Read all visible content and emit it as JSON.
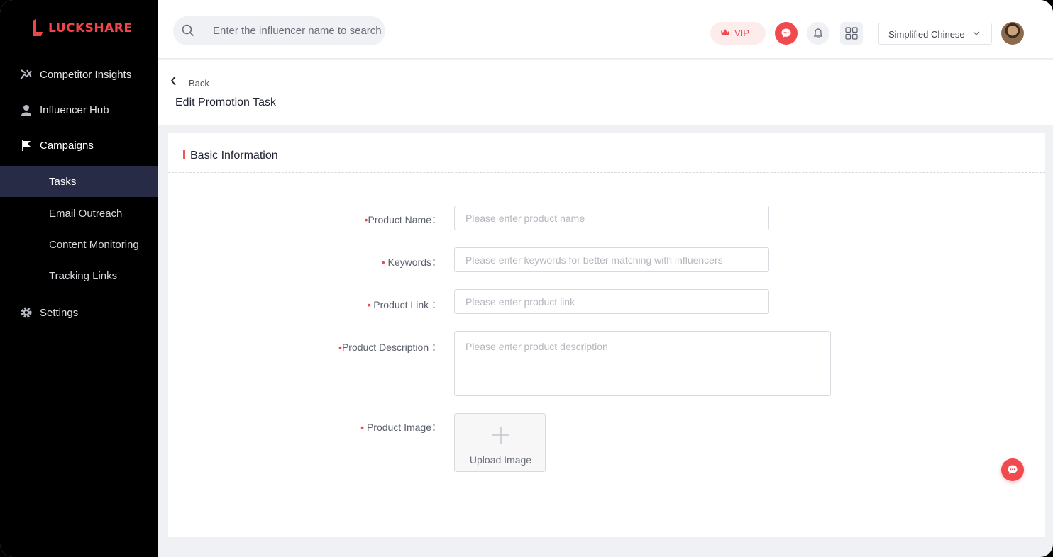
{
  "brand": {
    "name": "LUCKSHARE",
    "accent": "#f0454a"
  },
  "sidebar": {
    "items": [
      {
        "label": "Competitor Insights",
        "icon": "insights-icon"
      },
      {
        "label": "Influencer Hub",
        "icon": "user-icon"
      },
      {
        "label": "Campaigns",
        "icon": "flag-icon"
      }
    ],
    "sub_items": [
      {
        "label": "Tasks",
        "active": true
      },
      {
        "label": "Email Outreach"
      },
      {
        "label": "Content Monitoring"
      },
      {
        "label": "Tracking Links"
      }
    ],
    "settings": {
      "label": "Settings",
      "icon": "gear-icon"
    }
  },
  "topbar": {
    "search_placeholder": "Enter the influencer name to search",
    "vip_label": "VIP",
    "language": "Simplified Chinese"
  },
  "header": {
    "back_label": "Back",
    "title": "Edit Promotion Task"
  },
  "form": {
    "section_title": "Basic Information",
    "product_name": {
      "label": "Product Name：",
      "placeholder": "Please enter product name"
    },
    "keywords": {
      "label": " Keywords：",
      "placeholder": "Please enter keywords for better matching with influencers"
    },
    "product_link": {
      "label": " Product Link ：",
      "placeholder": "Please enter product link"
    },
    "product_description": {
      "label": "Product Description ：",
      "placeholder": "Please enter product description"
    },
    "product_image": {
      "label": " Product Image：",
      "upload_label": "Upload Image"
    },
    "required_mark": "•"
  }
}
